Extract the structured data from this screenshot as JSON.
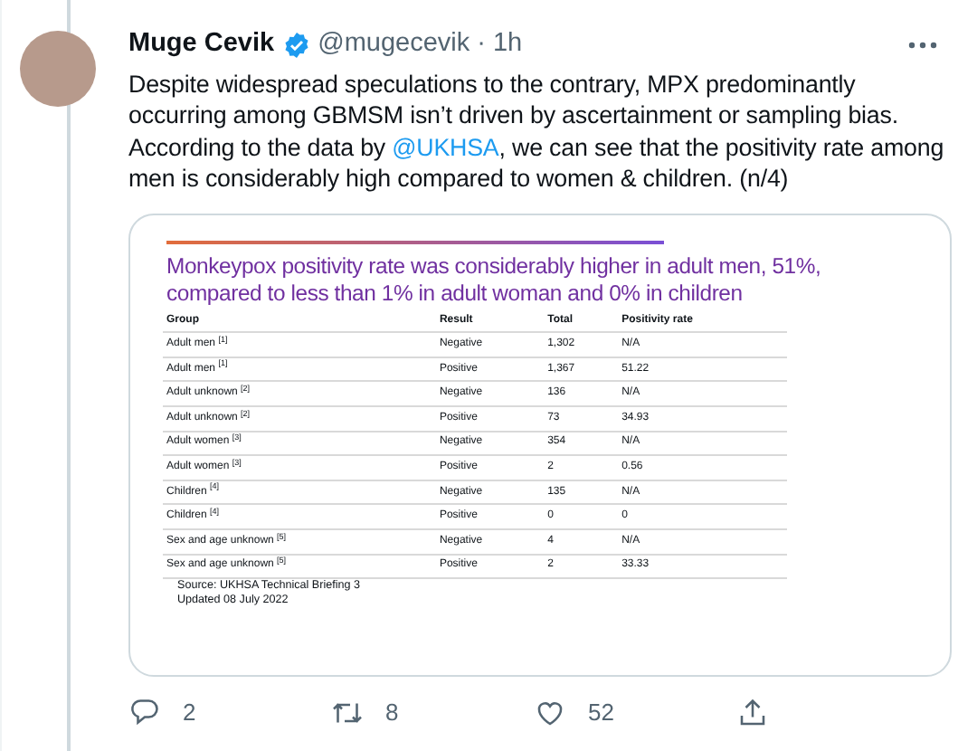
{
  "tweet": {
    "author": {
      "name": "Muge Cevik",
      "verified": true,
      "handle": "@mugecevik",
      "time": "· 1h"
    },
    "text": "Despite widespread speculations to the contrary, MPX predominantly occurring among GBMSM isn’t driven by ascertainment or sampling bias. According to the data by ",
    "mention": "@UKHSA",
    "text_after": ", we can see that the positivity rate among men is considerably high compared to women & children. (n/4)",
    "media": {
      "title": "Monkeypox positivity rate was considerably higher in adult men, 51%, compared to less than 1% in adult woman and 0% in children",
      "table": {
        "columns": [
          "Group",
          "Result",
          "Total",
          "Positivity rate"
        ],
        "rows": [
          [
            "Adult men $^{[1]}$",
            "Negative",
            "1,302",
            "N/A"
          ],
          [
            "Adult men $^{[1]}$",
            "Positive",
            "1,367",
            "51.22"
          ],
          [
            "Adult unknown $^{[2]}$",
            "Negative",
            "136",
            "N/A"
          ],
          [
            "Adult unknown $^{[2]}$",
            "Positive",
            "73",
            "34.93"
          ],
          [
            "Adult women $^{[3]}$",
            "Negative",
            "354",
            "N/A"
          ],
          [
            "Adult women $^{[3]}$",
            "Positive",
            "2",
            "0.56"
          ],
          [
            "Children $^{[4]}$",
            "Negative",
            "135",
            "N/A"
          ],
          [
            "Children $^{[4]}$",
            "Positive",
            "0",
            "0"
          ],
          [
            "Sex and age unknown $^{[5]}$",
            "Negative",
            "4",
            "N/A"
          ],
          [
            "Sex and age unknown $^{[5]}$",
            "Positive",
            "2",
            "33.33"
          ]
        ]
      },
      "source": [
        "Source: UKHSA Technical Briefing 3",
        "Updated 08 July 2022"
      ]
    },
    "actions": [
      {
        "kind": "reply",
        "count": "2"
      },
      {
        "kind": "retweet",
        "count": "8"
      },
      {
        "kind": "like",
        "count": "52"
      },
      {
        "kind": "share"
      }
    ]
  }
}
